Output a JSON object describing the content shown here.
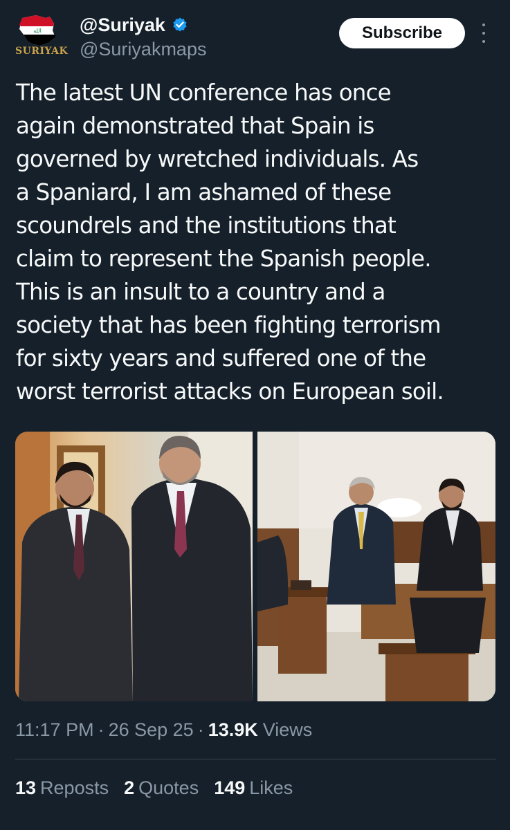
{
  "author": {
    "display_name": "@Suriyak",
    "handle": "@Suriyakmaps",
    "avatar_text": "SURIYAK",
    "verified_icon": "verified-badge-icon"
  },
  "actions": {
    "subscribe_label": "Subscribe",
    "more_icon": "more-vertical-icon"
  },
  "tweet": {
    "text": "The latest UN conference has once\nagain demonstrated that Spain is\ngoverned by wretched individuals. As\na Spaniard, I am ashamed of these\nscoundrels and the institutions that\nclaim to represent the Spanish people.\nThis is an insult to a country and a\nsociety that has been fighting terrorism\nfor sixty years and suffered one of the\nworst terrorist attacks on European soil."
  },
  "meta": {
    "time": "11:17 PM",
    "date": "26 Sep 25",
    "views_count": "13.9K",
    "views_label": "Views",
    "separator": "·"
  },
  "stats": [
    {
      "count": "13",
      "label": "Reposts"
    },
    {
      "count": "2",
      "label": "Quotes"
    },
    {
      "count": "149",
      "label": "Likes"
    }
  ],
  "colors": {
    "background": "#15202b",
    "text_primary": "#f7f9f9",
    "text_secondary": "#8b98a5",
    "verified": "#1d9bf0",
    "divider": "#38444d"
  }
}
